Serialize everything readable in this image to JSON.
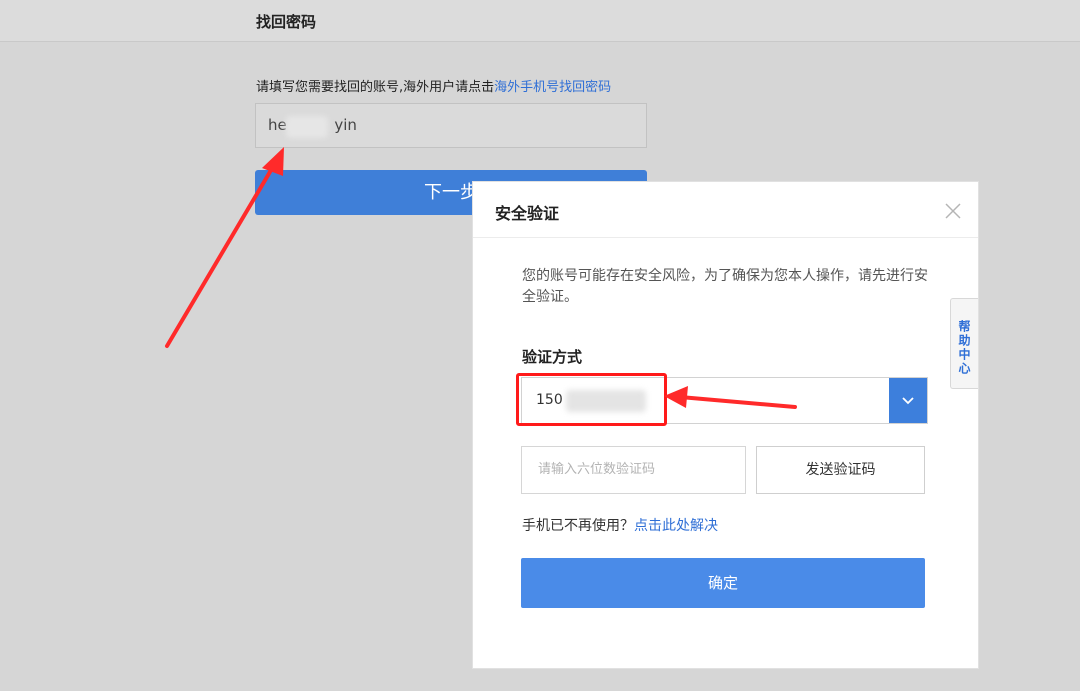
{
  "header": {
    "title": "找回密码"
  },
  "recover": {
    "instruction_text": "请填写您需要找回的账号,海外用户请点击",
    "overseas_link": "海外手机号找回密码",
    "account_prefix": "he",
    "account_suffix": "yin",
    "next_label": "下一步"
  },
  "modal": {
    "title": "安全验证",
    "description": "您的账号可能存在安全风险，为了确保为您本人操作，请先进行安全验证。",
    "method_label": "验证方式",
    "phone_prefix": "150",
    "code_placeholder": "请输入六位数验证码",
    "send_code_label": "发送验证码",
    "phone_help_text": "手机已不再使用？",
    "phone_help_link": "点击此处解决",
    "confirm_label": "确定"
  },
  "help_tab": {
    "label": "帮助中心"
  },
  "colors": {
    "primary": "#3f7fd8",
    "link": "#2f6fd6",
    "annotation": "#ff1a1a",
    "background": "#d6d6d6"
  }
}
